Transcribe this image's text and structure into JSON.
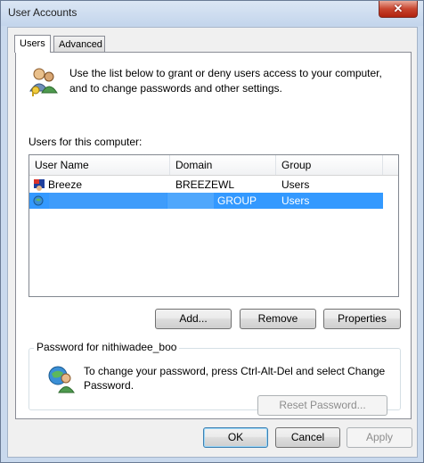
{
  "window": {
    "title": "User Accounts",
    "close_glyph": "✕"
  },
  "tabs": [
    {
      "label": "Users",
      "selected": true
    },
    {
      "label": "Advanced",
      "selected": false
    }
  ],
  "intro": {
    "icon": "users-keys-icon",
    "text": "Use the list below to grant or deny users access to your computer, and to change passwords and other settings."
  },
  "users_list": {
    "label": "Users for this computer:",
    "columns": [
      "User Name",
      "Domain",
      "Group"
    ],
    "rows": [
      {
        "user": "Breeze",
        "domain": "BREEZEWL",
        "group": "Users",
        "icon": "user-flag-icon",
        "selected": false
      },
      {
        "user": "",
        "domain": "GROUP",
        "group": "Users",
        "icon": "user-globe-icon",
        "selected": true
      }
    ]
  },
  "buttons": {
    "add": "Add...",
    "remove": "Remove",
    "properties": "Properties"
  },
  "password": {
    "legend": "Password for nithiwadee_boo",
    "icon": "user-globe-icon",
    "text": "To change your password, press Ctrl-Alt-Del and select Change Password.",
    "reset_label": "Reset Password..."
  },
  "dialog_buttons": {
    "ok": "OK",
    "cancel": "Cancel",
    "apply": "Apply"
  },
  "colors": {
    "selection": "#3399ff",
    "frame": "#c9d9ed",
    "close": "#c8452f"
  }
}
